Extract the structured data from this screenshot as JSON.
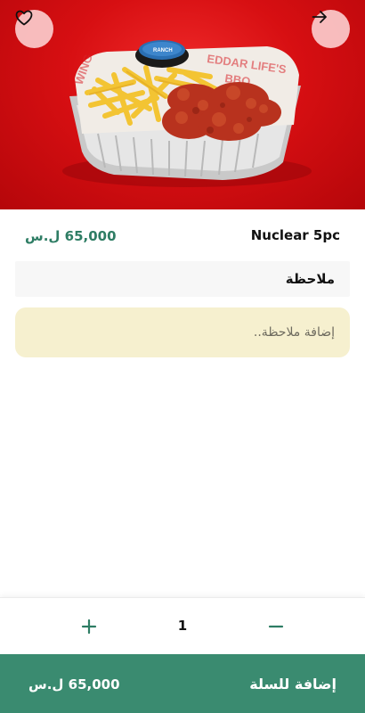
{
  "product": {
    "name": "Nuclear 5pc",
    "price": "65,000 ل.س",
    "image_icon": "fries-and-chicken-tray-photo"
  },
  "actions": {
    "favorite_icon": "heart-icon",
    "back_icon": "arrow-right-icon"
  },
  "note": {
    "header": "ملاحظة",
    "placeholder": "إضافة ملاحظة.."
  },
  "quantity": {
    "value": "1",
    "increase_icon": "plus-icon",
    "decrease_icon": "minus-icon"
  },
  "cart": {
    "label": "إضافة للسلة",
    "total": "65,000 ل.س"
  },
  "colors": {
    "accent": "#3a8b70",
    "price_text": "#2e7d64",
    "note_background": "#f6f0cf",
    "hero_background": "#d70f12"
  }
}
